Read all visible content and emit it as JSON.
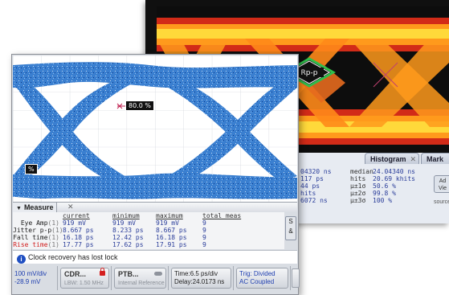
{
  "back_window": {
    "eye_label": "Rp-p",
    "histogram_tab": "Histogram",
    "histogram_close": "✕",
    "marker_tab": "Mark",
    "stats": [
      {
        "left": "04320 ns",
        "key": "median",
        "value": "24.04340 ns"
      },
      {
        "left": "117 ps",
        "key": "hits",
        "value": "20.69 khits"
      },
      {
        "left": "44 ps",
        "key": "μ±1σ",
        "value": "50.6 %"
      },
      {
        "left": "hits",
        "key": "μ±2σ",
        "value": "99.8 %"
      },
      {
        "left": "6072 ns",
        "key": "μ±3σ",
        "value": "100 %"
      }
    ],
    "side_button": "Ad Vie",
    "source_label": "source"
  },
  "front_window": {
    "eye_percent_label": "80.0 %",
    "left_marker_label": "%",
    "measure_tab": "Measure",
    "measure_close": "✕",
    "columns": [
      "current",
      "minimum",
      "maximum",
      "total meas"
    ],
    "rows": [
      {
        "name": "Eye Amp",
        "ch": "(1)",
        "current": "919 mV",
        "minimum": "919 mV",
        "maximum": "919 mV",
        "total": "9",
        "red": false
      },
      {
        "name": "Jitter p-p",
        "ch": "(1)",
        "current": "8.667 ps",
        "minimum": "8.233 ps",
        "maximum": "8.667 ps",
        "total": "9",
        "red": false
      },
      {
        "name": "Fall time",
        "ch": "(1)",
        "current": "16.18 ps",
        "minimum": "12.42 ps",
        "maximum": "16.18 ps",
        "total": "9",
        "red": false
      },
      {
        "name": "Rise time",
        "ch": "(1)",
        "current": "17.77 ps",
        "minimum": "17.62 ps",
        "maximum": "17.91 ps",
        "total": "9",
        "red": true
      }
    ],
    "right_button": "S &",
    "status_message": "Clock recovery has lost lock",
    "scale": {
      "line1": "100 mV/div",
      "line2": "-28.9 mV"
    },
    "cdr": {
      "title": "CDR...",
      "sub": "LBW: 1.50 MHz"
    },
    "ptb": {
      "title": "PTB...",
      "sub": "Internal Reference"
    },
    "time": {
      "line1": "Time:6.5 ps/div",
      "line2": "Delay:24.0173 ns"
    },
    "trig": {
      "line1": "Trig: Divided",
      "line2": "AC Coupled"
    }
  },
  "colors": {
    "eye_blue": "#3a7fd0",
    "status_blue": "#1f4fc2",
    "alert_red": "#d12020"
  }
}
